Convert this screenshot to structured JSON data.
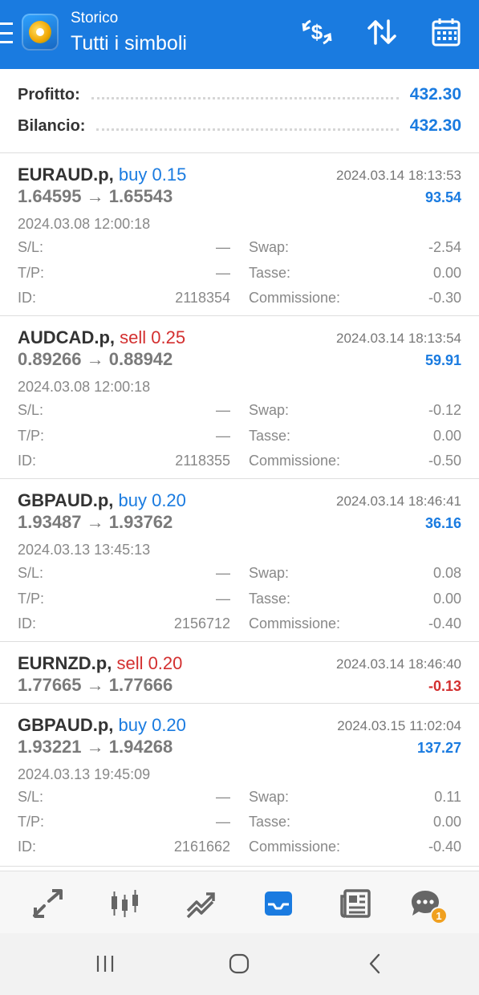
{
  "header": {
    "subtitle": "Storico",
    "title": "Tutti i simboli",
    "icons": [
      "menu-icon",
      "app-logo",
      "currency-exchange-icon",
      "sort-icon",
      "calendar-icon"
    ]
  },
  "summary": {
    "profit_label": "Profitto:",
    "profit_value": "432.30",
    "balance_label": "Bilancio:",
    "balance_value": "432.30"
  },
  "labels": {
    "sl": "S/L:",
    "tp": "T/P:",
    "id": "ID:",
    "swap": "Swap:",
    "taxes": "Tasse:",
    "commission": "Commissione:"
  },
  "deals": [
    {
      "symbol": "EURAUD.p,",
      "type": "buy 0.15",
      "direction": "buy",
      "close_time": "2024.03.14 18:13:53",
      "prices": "1.64595 → 1.65543",
      "profit": "93.54",
      "open_time": "2024.03.08 12:00:18",
      "sl": "—",
      "tp": "—",
      "id": "2118354",
      "swap": "-2.54",
      "taxes": "0.00",
      "commission": "-0.30"
    },
    {
      "symbol": "AUDCAD.p,",
      "type": "sell 0.25",
      "direction": "sell",
      "close_time": "2024.03.14 18:13:54",
      "prices": "0.89266 → 0.88942",
      "profit": "59.91",
      "open_time": "2024.03.08 12:00:18",
      "sl": "—",
      "tp": "—",
      "id": "2118355",
      "swap": "-0.12",
      "taxes": "0.00",
      "commission": "-0.50"
    },
    {
      "symbol": "GBPAUD.p,",
      "type": "buy 0.20",
      "direction": "buy",
      "close_time": "2024.03.14 18:46:41",
      "prices": "1.93487 → 1.93762",
      "profit": "36.16",
      "open_time": "2024.03.13 13:45:13",
      "sl": "—",
      "tp": "—",
      "id": "2156712",
      "swap": "0.08",
      "taxes": "0.00",
      "commission": "-0.40"
    },
    {
      "symbol": "EURNZD.p,",
      "type": "sell 0.20",
      "direction": "sell",
      "close_time": "2024.03.14 18:46:40",
      "prices": "1.77665 → 1.77666",
      "profit": "-0.13"
    },
    {
      "symbol": "GBPAUD.p,",
      "type": "buy 0.20",
      "direction": "buy",
      "close_time": "2024.03.15 11:02:04",
      "prices": "1.93221 → 1.94268",
      "profit": "137.27",
      "open_time": "2024.03.13 19:45:09",
      "sl": "—",
      "tp": "—",
      "id": "2161662",
      "swap": "0.11",
      "taxes": "0.00",
      "commission": "-0.40"
    }
  ],
  "bottom_nav": {
    "items": [
      "quotes-icon",
      "chart-icon",
      "trade-icon",
      "history-icon",
      "news-icon",
      "chat-icon"
    ],
    "active": "history-icon",
    "chat_badge": "1"
  },
  "system_nav": [
    "recent-apps-icon",
    "home-icon",
    "back-icon"
  ],
  "colors": {
    "accent": "#1a7be0",
    "sell": "#d32f2f",
    "badge": "#f0a020"
  }
}
